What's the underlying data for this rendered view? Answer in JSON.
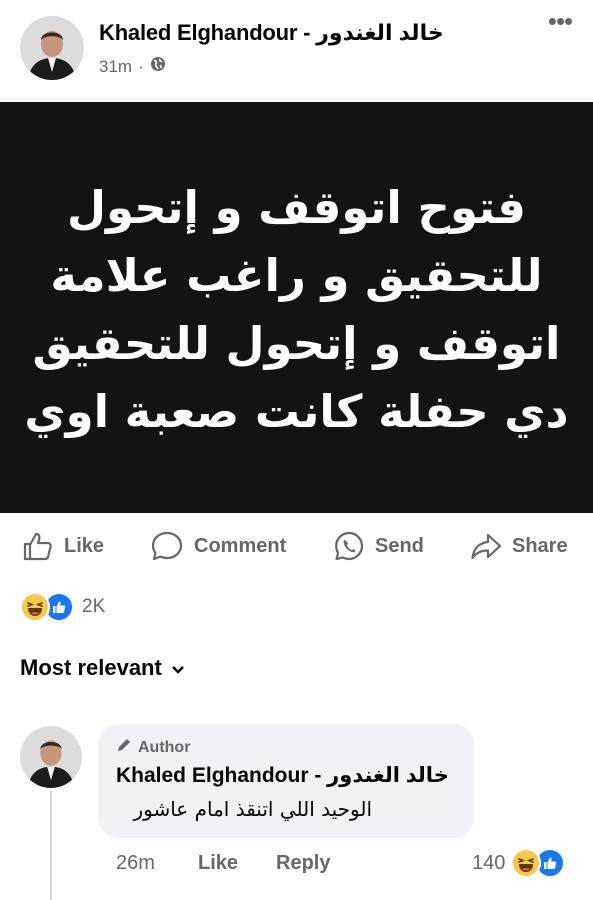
{
  "post": {
    "author": "Khaled Elghandour - خالد الغندور",
    "time": "31m",
    "privacy_icon": "globe-icon",
    "image_text": "فتوح اتوقف و إتحول\nللتحقيق و راغب علامة\nاتوقف و إتحول للتحقيق\nدي حفلة كانت صعبة  اوي",
    "image_bg": "#131313"
  },
  "actions": {
    "like": "Like",
    "comment": "Comment",
    "send": "Send",
    "share": "Share"
  },
  "reactions": {
    "count": "2K",
    "types": [
      "haha",
      "like"
    ]
  },
  "comments_sort": {
    "label": "Most relevant"
  },
  "comment": {
    "badge": "Author",
    "author": "Khaled Elghandour - خالد الغندور",
    "text": "الوحيد اللي اتنقذ امام عاشور",
    "time": "26m",
    "like": "Like",
    "reply": "Reply",
    "reaction_count": "140",
    "reaction_types": [
      "haha",
      "like"
    ]
  },
  "colors": {
    "text": "#050505",
    "secondary": "#65676b",
    "bubble": "#f0f2f5",
    "accent": "#1877f2"
  }
}
